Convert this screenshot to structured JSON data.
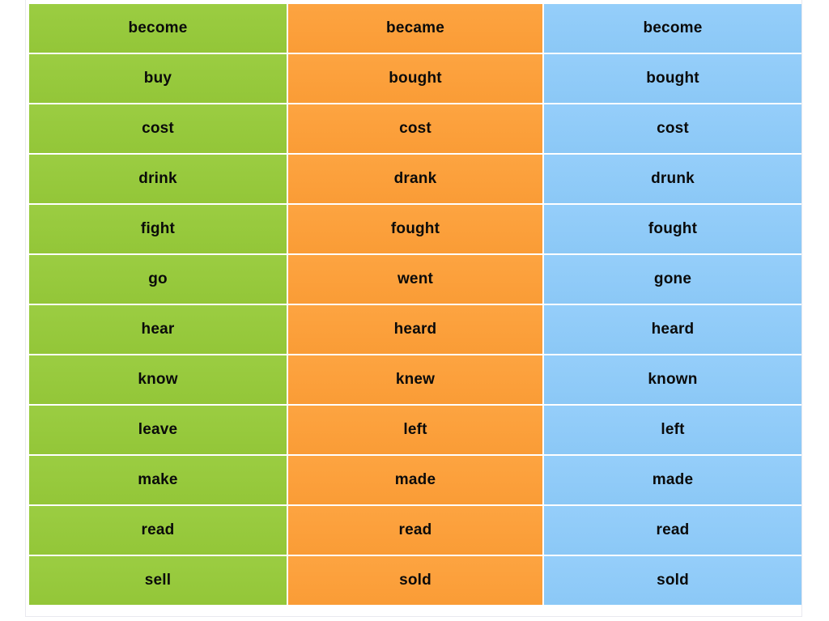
{
  "document": {
    "kind": "irregular-verbs-table",
    "columns": [
      {
        "key": "base",
        "color": "#97c93d"
      },
      {
        "key": "past",
        "color": "#fca03c"
      },
      {
        "key": "participle",
        "color": "#90cbf8"
      }
    ]
  },
  "rows": [
    {
      "base": "become",
      "past": "became",
      "participle": "become"
    },
    {
      "base": "buy",
      "past": "bought",
      "participle": "bought"
    },
    {
      "base": "cost",
      "past": "cost",
      "participle": "cost"
    },
    {
      "base": "drink",
      "past": "drank",
      "participle": "drunk"
    },
    {
      "base": "fight",
      "past": "fought",
      "participle": "fought"
    },
    {
      "base": "go",
      "past": "went",
      "participle": "gone"
    },
    {
      "base": "hear",
      "past": "heard",
      "participle": "heard"
    },
    {
      "base": "know",
      "past": "knew",
      "participle": "known"
    },
    {
      "base": "leave",
      "past": "left",
      "participle": "left"
    },
    {
      "base": "make",
      "past": "made",
      "participle": "made"
    },
    {
      "base": "read",
      "past": "read",
      "participle": "read"
    },
    {
      "base": "sell",
      "past": "sold",
      "participle": "sold"
    }
  ]
}
